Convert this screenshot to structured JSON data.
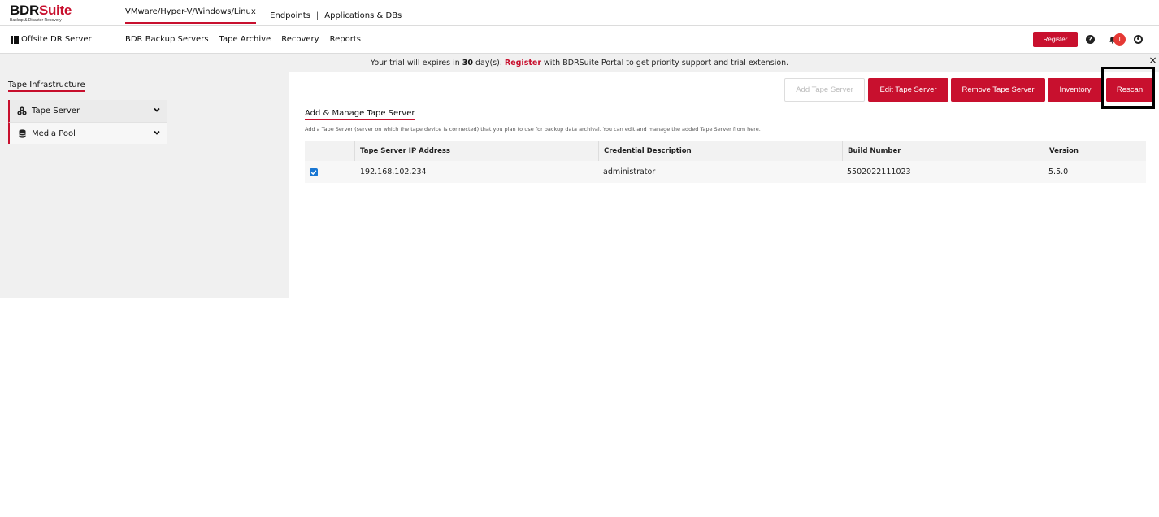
{
  "brand": {
    "name_bold": "BDR",
    "name_accent": "Suite",
    "tagline": "Backup & Disaster Recovery",
    "accent_color": "#c8102e"
  },
  "top_nav": {
    "items": [
      {
        "label": "VMware/Hyper-V/Windows/Linux",
        "active": true
      },
      {
        "label": "Endpoints",
        "active": false
      },
      {
        "label": "Applications & DBs",
        "active": false
      }
    ],
    "separator": "|"
  },
  "sub_nav": {
    "server_menu": "Offsite DR Server",
    "items": [
      {
        "label": "BDR Backup Servers",
        "active": false
      },
      {
        "label": "Tape Archive",
        "active": true
      },
      {
        "label": "Recovery",
        "active": false
      },
      {
        "label": "Reports",
        "active": false
      }
    ],
    "register_label": "Register",
    "notification_count": "1",
    "icons": [
      "help-icon",
      "bell-icon",
      "user-icon"
    ]
  },
  "banner": {
    "text_1": "Your trial will expires in ",
    "days": "30",
    "text_2": " day(s). ",
    "register": "Register",
    "text_3": " with BDRSuite Portal to get priority support and trial extension.",
    "close": "×"
  },
  "sidebar": {
    "title": "Tape Infrastructure",
    "items": [
      {
        "label": "Tape Server",
        "icon": "servers-icon"
      },
      {
        "label": "Media Pool",
        "icon": "database-icon"
      }
    ]
  },
  "toolbar": {
    "add": "Add Tape Server",
    "edit": "Edit Tape Server",
    "remove": "Remove Tape Server",
    "inventory": "Inventory",
    "rescan": "Rescan"
  },
  "section": {
    "title": "Add & Manage Tape Server",
    "description": "Add a Tape Server (server on which the tape device is connected) that you plan to use for backup data archival. You can edit and manage the added Tape Server from here."
  },
  "table": {
    "columns": [
      "Tape Server IP Address",
      "Credential Description",
      "Build Number",
      "Version"
    ],
    "rows": [
      {
        "checked": true,
        "ip": "192.168.102.234",
        "credential": "administrator",
        "build": "5502022111023",
        "version": "5.5.0"
      }
    ]
  }
}
